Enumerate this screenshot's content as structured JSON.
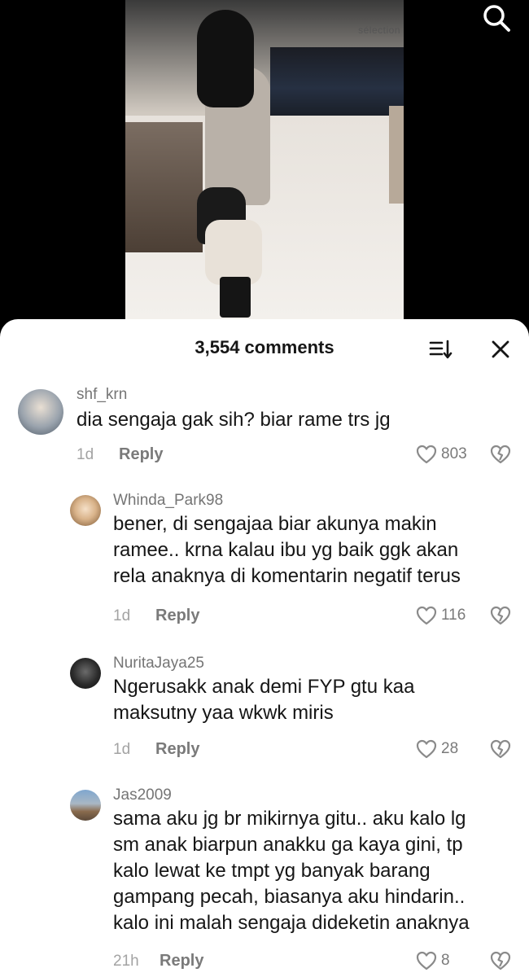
{
  "video": {
    "store_sign": "sélection"
  },
  "header": {
    "comments_count": "3,554 comments"
  },
  "comments": [
    {
      "username": "shf_krn",
      "text": "dia sengaja gak sih? biar rame trs jg",
      "time": "1d",
      "reply_label": "Reply",
      "likes": "803"
    },
    {
      "username": "Whinda_Park98",
      "text_lines": [
        "bener, di sengajaa biar akunya makin",
        "ramee.. krna kalau ibu yg baik ggk akan",
        "rela anaknya di komentarin negatif terus"
      ],
      "time": "1d",
      "reply_label": "Reply",
      "likes": "116"
    },
    {
      "username": "NuritaJaya25",
      "text_lines": [
        "Ngerusakk anak demi FYP gtu kaa",
        "maksutny yaa wkwk miris"
      ],
      "time": "1d",
      "reply_label": "Reply",
      "likes": "28"
    },
    {
      "username": "Jas2009",
      "text_lines": [
        "sama aku jg br mikirnya gitu.. aku kalo lg",
        "sm anak biarpun anakku ga kaya gini, tp",
        "kalo lewat ke tmpt yg banyak barang",
        "gampang pecah, biasanya aku hindarin..",
        "kalo ini malah sengaja dideketin anaknya"
      ],
      "time": "21h",
      "reply_label": "Reply",
      "likes": "8"
    }
  ]
}
